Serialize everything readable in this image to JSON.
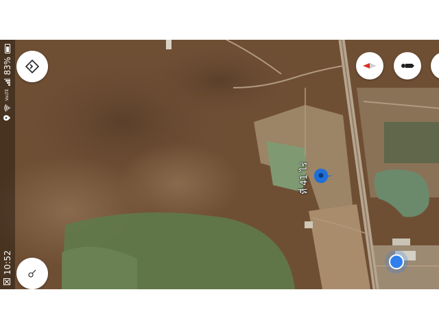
{
  "status_bar": {
    "time": "10:52",
    "battery": "83%",
    "network": "VoLTE",
    "icons": [
      "notification-x-icon",
      "wifi-icon",
      "signal-icon",
      "battery-icon",
      "location-icon"
    ]
  },
  "map": {
    "type": "satellite",
    "pin_label": "ที่ 41 ไร่",
    "colors": {
      "terrain": "#6f4f34",
      "vegetation": "#5f7a4a",
      "pond": "#7f9a72",
      "road": "#b8a58e",
      "pin": "#1f6fd8",
      "location_dot": "#2f80ed"
    }
  },
  "controls": {
    "icons": [
      "directions-icon",
      "compass-icon",
      "street-view-icon",
      "compass-needle-icon"
    ]
  }
}
